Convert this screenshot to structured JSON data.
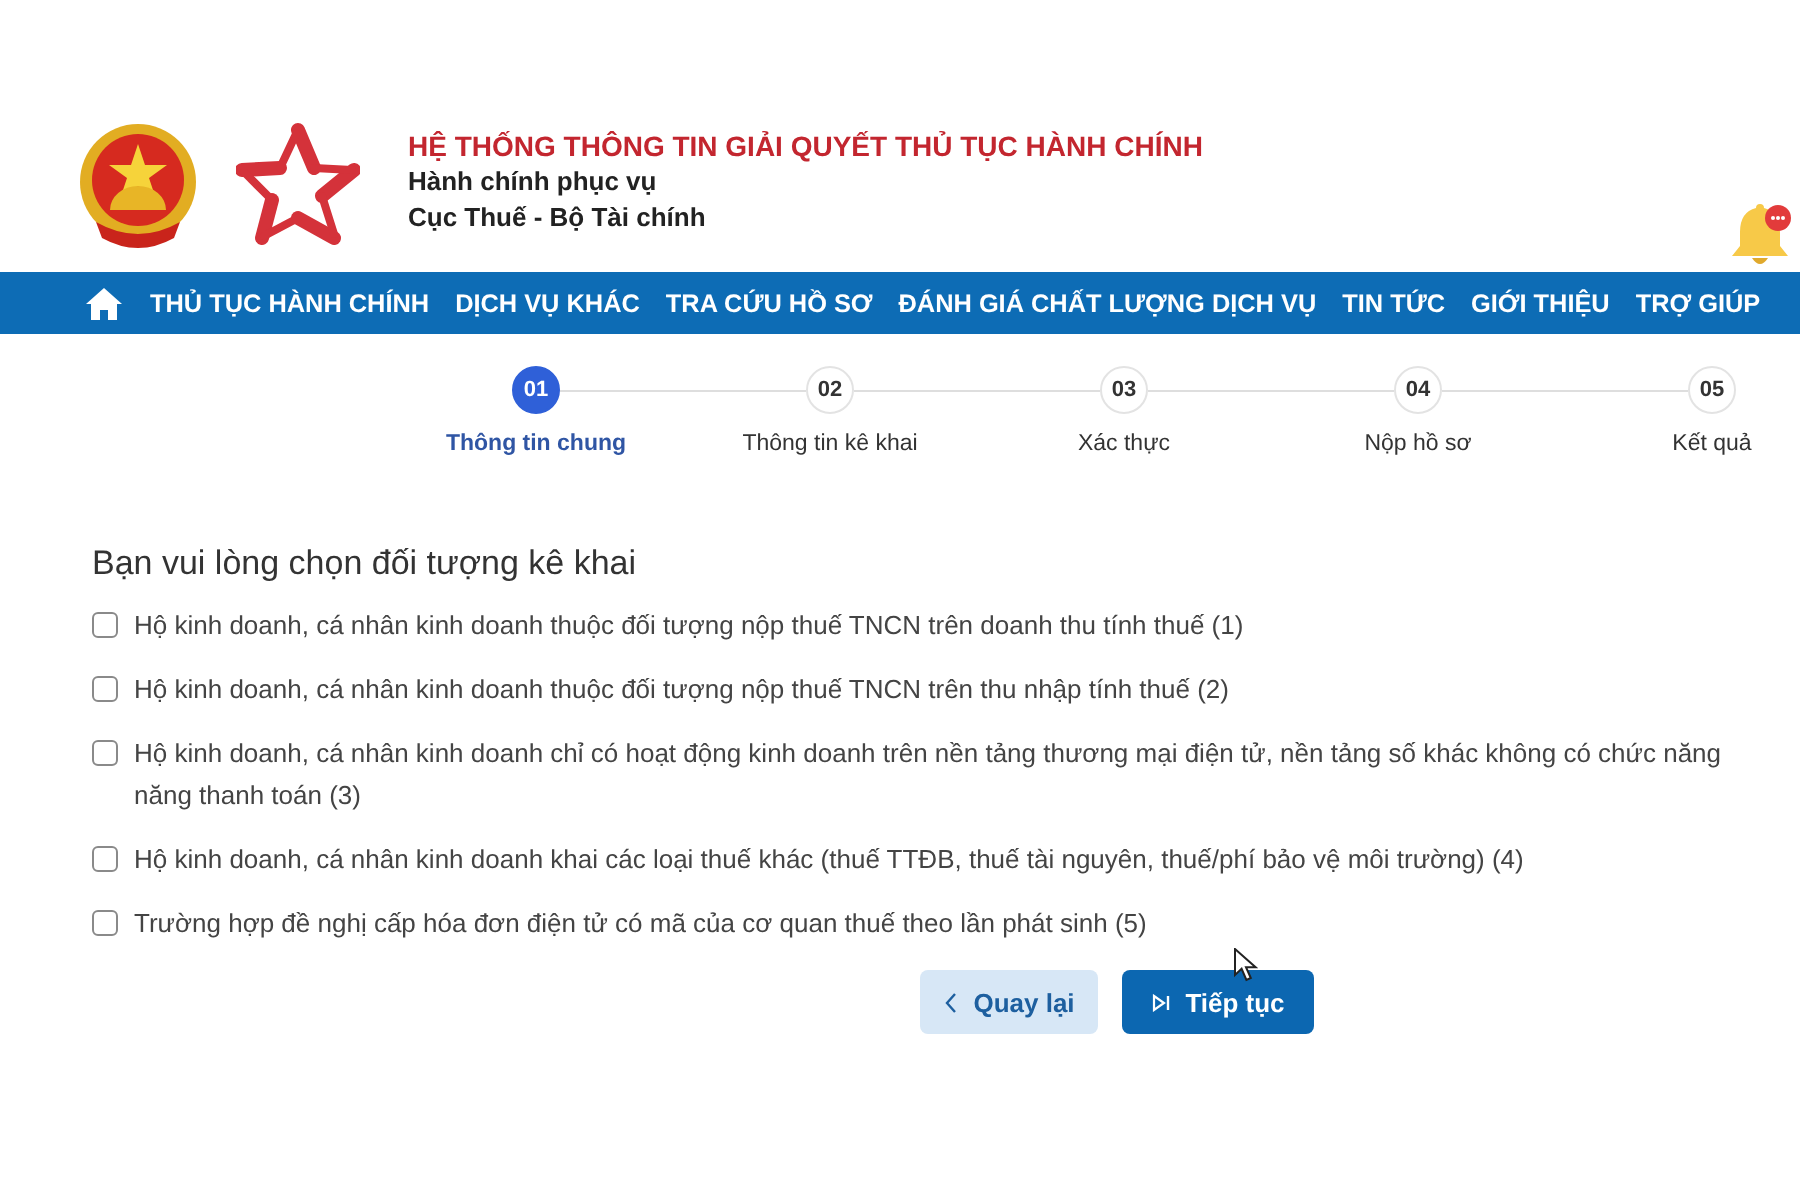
{
  "header": {
    "title": "HỆ THỐNG THÔNG TIN GIẢI QUYẾT THỦ TỤC HÀNH CHÍNH",
    "subtitle": "Hành chính phục vụ",
    "agency": "Cục Thuế - Bộ Tài chính"
  },
  "nav": {
    "items": [
      "THỦ TỤC HÀNH CHÍNH",
      "DỊCH VỤ KHÁC",
      "TRA CỨU HỒ SƠ",
      "ĐÁNH GIÁ CHẤT LƯỢNG DỊCH VỤ",
      "TIN TỨC",
      "GIỚI THIỆU",
      "TRỢ GIÚP"
    ]
  },
  "steps": [
    {
      "number": "01",
      "label": "Thông tin chung",
      "current": true
    },
    {
      "number": "02",
      "label": "Thông tin kê khai",
      "current": false
    },
    {
      "number": "03",
      "label": "Xác thực",
      "current": false
    },
    {
      "number": "04",
      "label": "Nộp hồ sơ",
      "current": false
    },
    {
      "number": "05",
      "label": "Kết quả",
      "current": false
    }
  ],
  "form": {
    "heading": "Bạn vui lòng chọn đối tượng kê khai",
    "options": [
      {
        "lines": [
          "Hộ kinh doanh, cá nhân kinh doanh thuộc đối tượng nộp thuế TNCN trên doanh thu tính thuế (1)"
        ],
        "checked": false
      },
      {
        "lines": [
          "Hộ kinh doanh, cá nhân kinh doanh thuộc đối tượng nộp thuế TNCN trên thu nhập tính thuế (2)"
        ],
        "checked": false
      },
      {
        "lines": [
          "Hộ kinh doanh, cá nhân kinh doanh chỉ có hoạt động kinh doanh trên nền tảng thương mại điện tử, nền tảng số khác không có chức năng",
          "năng thanh toán (3)"
        ],
        "checked": false
      },
      {
        "lines": [
          "Hộ kinh doanh, cá nhân kinh doanh khai các loại thuế khác (thuế TTĐB, thuế tài nguyên, thuế/phí bảo vệ môi trường) (4)"
        ],
        "checked": false
      },
      {
        "lines": [
          "Trường hợp đề nghị cấp hóa đơn điện tử có mã của cơ quan thuế theo lần phát sinh (5)"
        ],
        "checked": false
      }
    ]
  },
  "buttons": [
    {
      "kind": "back",
      "label": "Quay lại"
    },
    {
      "kind": "next",
      "label": "Tiếp tục"
    }
  ]
}
